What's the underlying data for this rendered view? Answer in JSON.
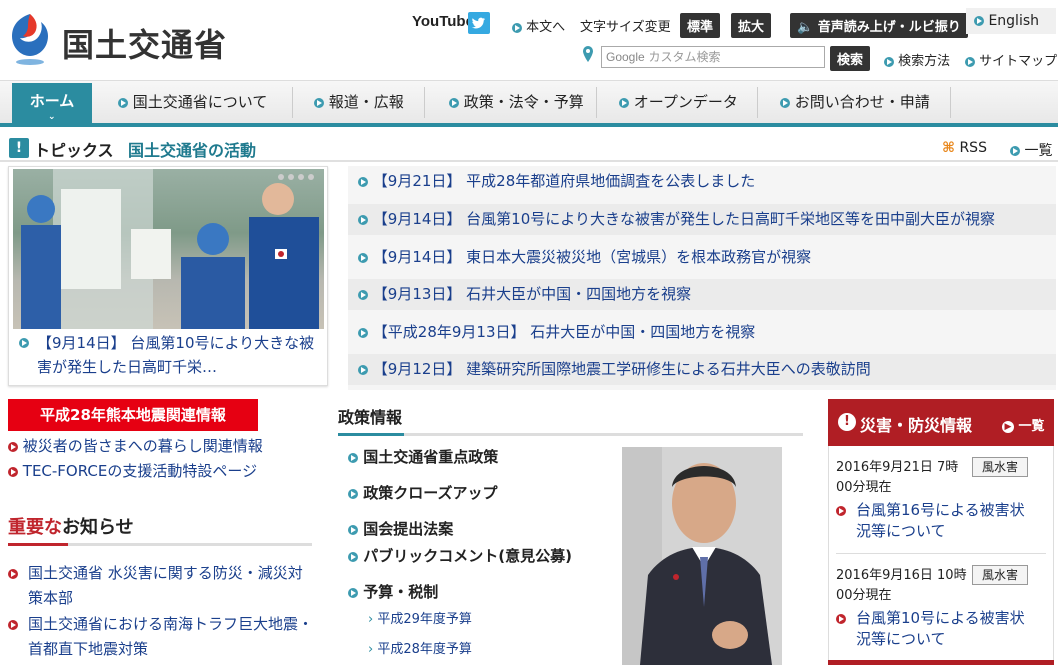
{
  "header": {
    "site_name": "国土交通省",
    "youtube_label": "YouTube",
    "main_text_link": "本文へ",
    "font_size_label": "文字サイズ変更",
    "font_standard": "標準",
    "font_large": "拡大",
    "voice_label": "音声読み上げ・ルビ振り",
    "english_label": "English",
    "search_placeholder": "カスタム検索",
    "search_google": "Google",
    "search_button": "検索",
    "search_method": "検索方法",
    "sitemap": "サイトマップ"
  },
  "nav": {
    "items": [
      "ホーム",
      "国土交通省について",
      "報道・広報",
      "政策・法令・予算",
      "オープンデータ",
      "お問い合わせ・申請"
    ]
  },
  "topics": {
    "label": "トピックス",
    "title": "国土交通省の活動",
    "rss": "RSS",
    "list_link": "一覧",
    "feature_caption": "【9月14日】 台風第10号により大きな被害が発生した日高町千栄…",
    "items": [
      "【9月21日】 平成28年都道府県地価調査を公表しました",
      "【9月14日】 台風第10号により大きな被害が発生した日高町千栄地区等を田中副大臣が視察",
      "【9月14日】 東日本大震災被災地（宮城県）を根本政務官が視察",
      "【9月13日】 石井大臣が中国・四国地方を視察",
      "【平成28年9月13日】 石井大臣が中国・四国地方を視察",
      "【9月12日】 建築研究所国際地震工学研修生による石井大臣への表敬訪問"
    ]
  },
  "kumamoto": {
    "banner": "平成28年熊本地震関連情報",
    "links": [
      "被災者の皆さまへの暮らし関連情報",
      "TEC-FORCEの支援活動特設ページ"
    ]
  },
  "notices": {
    "title_red": "重要な",
    "title_rest": "お知らせ",
    "items": [
      {
        "line1": "国土交通省 水災害に関する防災・減災対",
        "line2": "策本部"
      },
      {
        "line1": "国土交通省における南海トラフ巨大地震・",
        "line2": "首都直下地震対策"
      }
    ]
  },
  "policy": {
    "title": "政策情報",
    "items": [
      "国土交通省重点政策",
      "政策クローズアップ",
      "国会提出法案",
      "パブリックコメント(意見公募)",
      "予算・税制"
    ],
    "subitems": [
      "平成29年度予算",
      "平成28年度予算"
    ]
  },
  "disaster": {
    "title": "災害・防災情報",
    "list_link": "一覧",
    "items": [
      {
        "date": "2016年9月21日 7時",
        "status": "00分現在",
        "tag": "風水害",
        "line1": "台風第16号による被害状",
        "line2": "況等について"
      },
      {
        "date": "2016年9月16日 10時",
        "status": "00分現在",
        "tag": "風水害",
        "line1": "台風第10号による被害状",
        "line2": "況等について"
      }
    ]
  },
  "colors": {
    "accent": "#2b8ca0",
    "danger": "#c0252d",
    "link": "#1a3f8c"
  }
}
